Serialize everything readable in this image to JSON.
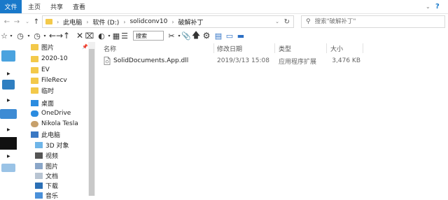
{
  "ribbon": {
    "file": "文件",
    "tabs": [
      "主页",
      "共享",
      "查看"
    ]
  },
  "address": {
    "crumbs": [
      "此电脑",
      "软件 (D:)",
      "solidconv10",
      "破解补丁"
    ],
    "search_placeholder": "搜索\"破解补丁\""
  },
  "toolbar": {
    "search_label": "搜索"
  },
  "nav": {
    "quick": [
      "图片",
      "2020-10",
      "EV",
      "FileRecv",
      "临时"
    ],
    "desktop": "桌面",
    "onedrive": "OneDrive",
    "user": "Nikola Tesla",
    "thispc": "此电脑",
    "pc_items": [
      "3D 对象",
      "视频",
      "图片",
      "文档",
      "下载",
      "音乐"
    ]
  },
  "columns": [
    "名称",
    "修改日期",
    "类型",
    "大小"
  ],
  "files": [
    {
      "name": "SolidDocuments.App.dll",
      "date": "2019/3/13 15:08",
      "type": "应用程序扩展",
      "size": "3,476 KB"
    }
  ]
}
